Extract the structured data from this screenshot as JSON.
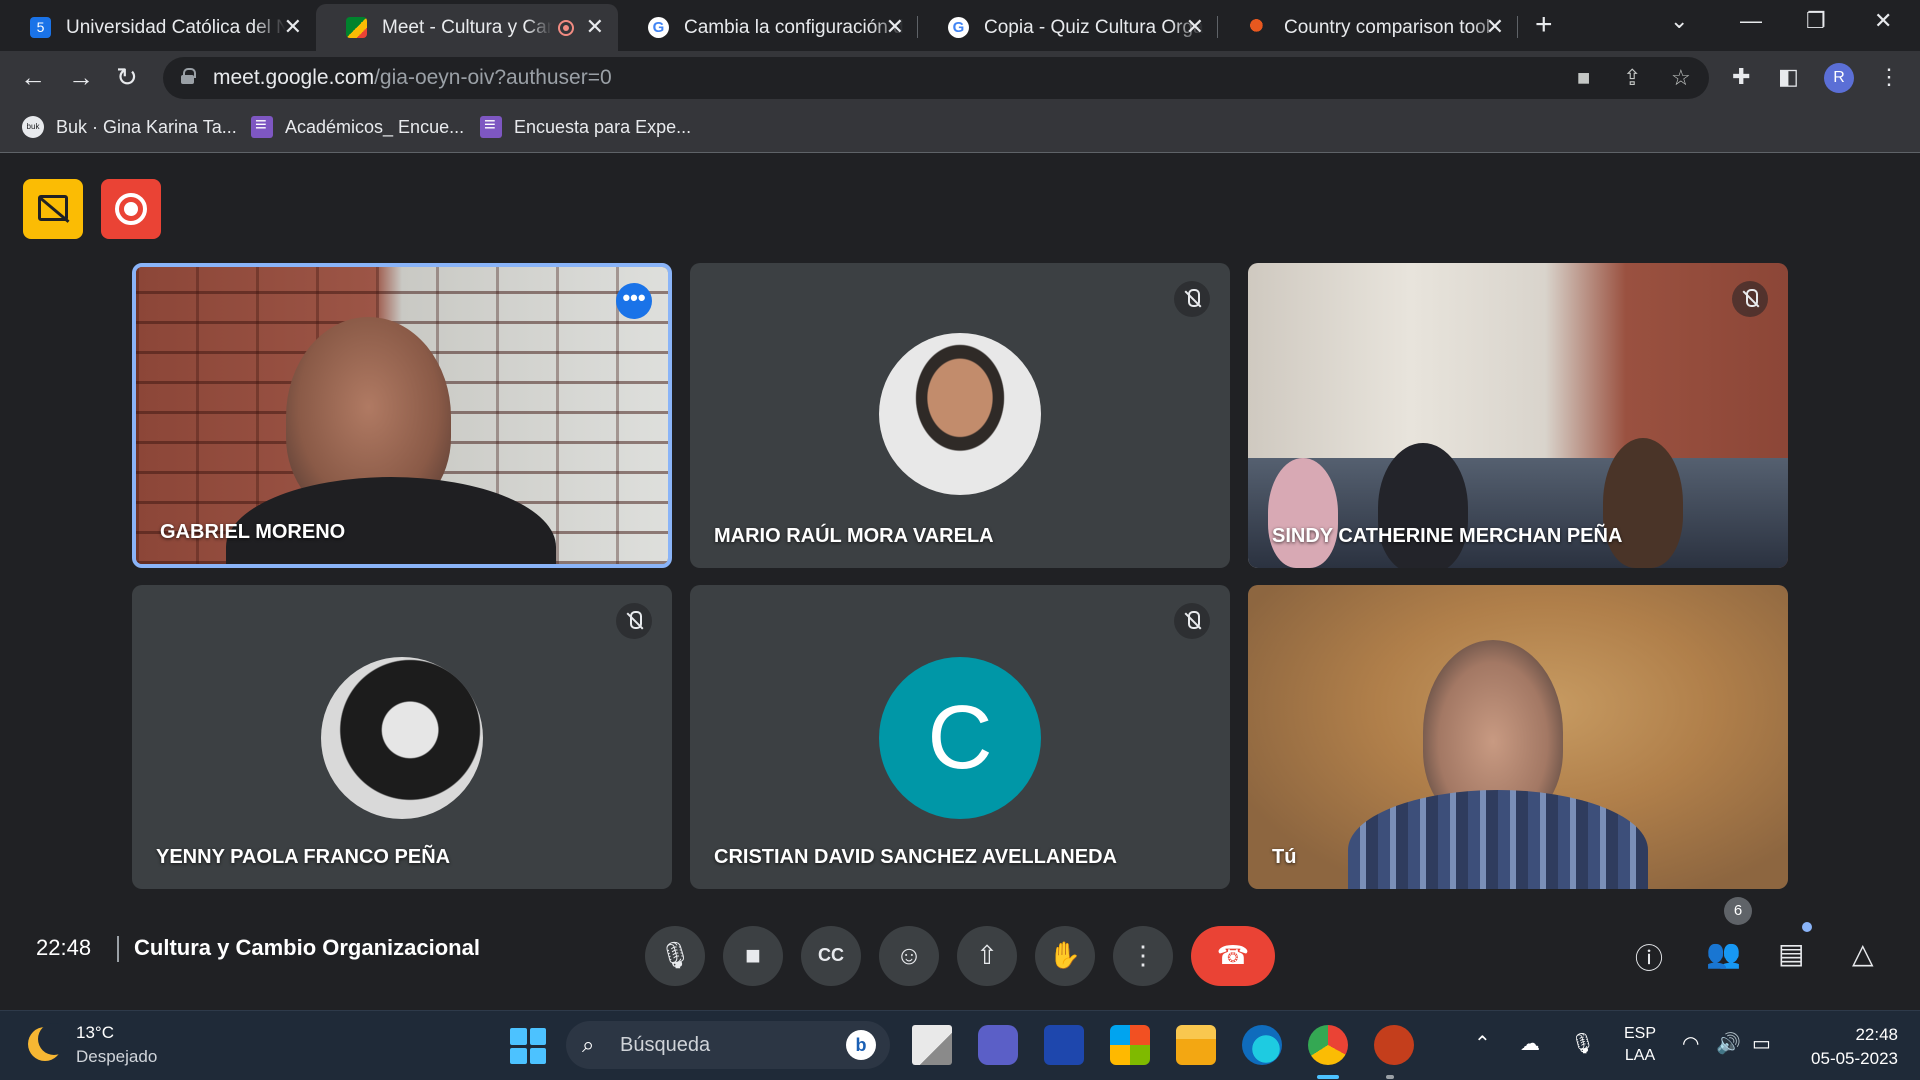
{
  "browser": {
    "tabs": [
      {
        "title": "Universidad Católica del N",
        "favicon_color": "#1a73e8",
        "favicon_text": "5",
        "active": false
      },
      {
        "title": "Meet - Cultura y Cam",
        "favicon_color": "#00832d",
        "favicon_text": "",
        "active": true,
        "recording": true
      },
      {
        "title": "Cambia la configuración d",
        "favicon_color": "#ffffff",
        "favicon_text": "G",
        "active": false
      },
      {
        "title": "Copia - Quiz Cultura Orga",
        "favicon_color": "#ffffff",
        "favicon_text": "G",
        "active": false
      },
      {
        "title": "Country comparison tool",
        "favicon_color": "#e8581f",
        "favicon_text": "",
        "active": false
      }
    ],
    "url_host": "meet.google.com",
    "url_path": "/gia-oeyn-oiv?authuser=0",
    "profile_initial": "R",
    "bookmarks": [
      {
        "label": "Buk · Gina Karina Ta...",
        "icon": "buk-icon",
        "icon_text": "buk"
      },
      {
        "label": "Académicos_ Encue...",
        "icon": "forms-icon",
        "icon_text": ""
      },
      {
        "label": "Encuesta para Expe...",
        "icon": "forms-icon",
        "icon_text": ""
      }
    ]
  },
  "meet": {
    "participants": [
      {
        "name": "GABRIEL MORENO",
        "type": "video",
        "active_speaker": true,
        "muted": false
      },
      {
        "name": "MARIO RAÚL MORA VARELA",
        "type": "photo",
        "muted": true
      },
      {
        "name": "SINDY CATHERINE MERCHAN PEÑA",
        "type": "video",
        "muted": true
      },
      {
        "name": "YENNY PAOLA FRANCO PEÑA",
        "type": "photo",
        "muted": true
      },
      {
        "name": "CRISTIAN DAVID SANCHEZ AVELLANEDA",
        "type": "letter",
        "letter": "C",
        "muted": true
      },
      {
        "name": "Tú",
        "type": "video",
        "muted": false
      }
    ],
    "time": "22:48",
    "meeting_title": "Cultura y Cambio Organizacional",
    "participant_count": "6",
    "more_glyph": "•••"
  },
  "taskbar": {
    "temperature": "13°C",
    "weather": "Despejado",
    "search_placeholder": "Búsqueda",
    "language_line1": "ESP",
    "language_line2": "LAA",
    "clock_time": "22:48",
    "clock_date": "05-05-2023"
  },
  "colors": {
    "meet_bg": "#202124",
    "tile_bg": "#3c4043",
    "active_border": "#8ab4f8",
    "end_call": "#ea4335",
    "record_badge": "#ea4335",
    "no_video_badge": "#fbbc04",
    "letter_avatar": "#0097a7"
  }
}
